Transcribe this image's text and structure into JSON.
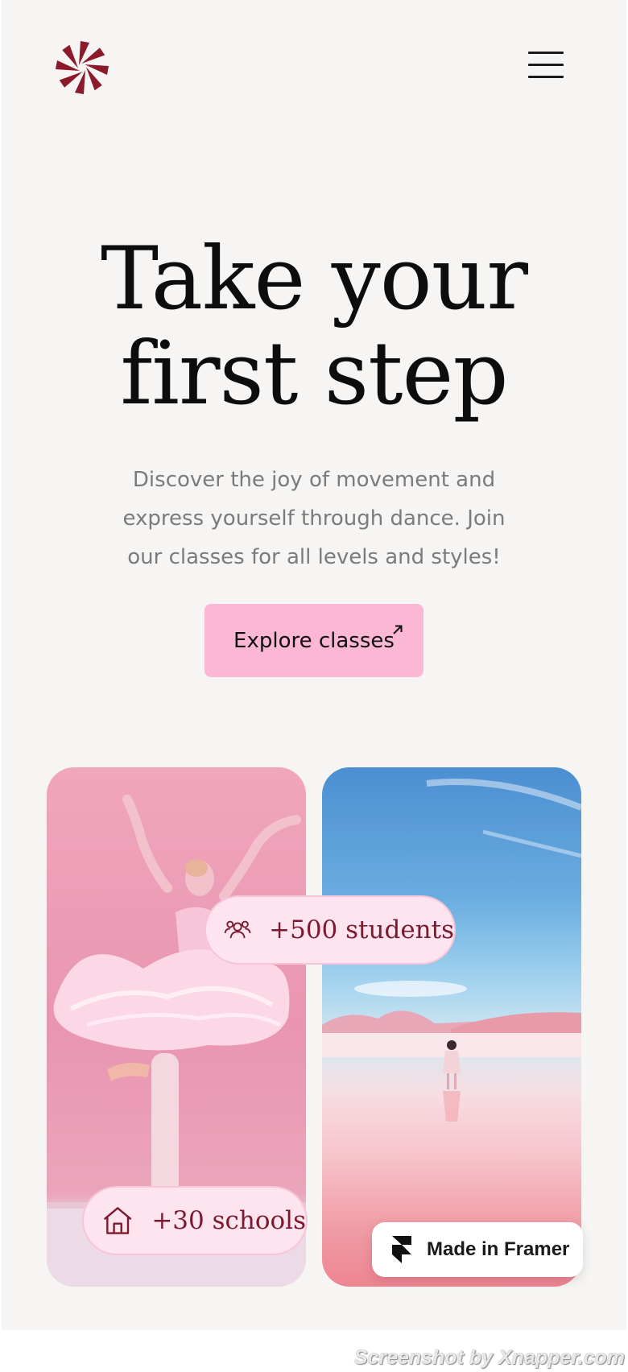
{
  "header": {
    "logo_icon": "pinwheel-logo-icon",
    "menu_icon": "hamburger-menu-icon",
    "brand_color": "#8b1a2b"
  },
  "hero": {
    "title_line1": "Take your",
    "title_line2": "first step",
    "subtitle_line1": "Discover the joy of movement and",
    "subtitle_line2": "express yourself through dance. Join",
    "subtitle_line3": "our classes for all levels and styles!",
    "cta_label": "Explore classes",
    "cta_icon": "arrow-up-right-icon",
    "cta_color": "#fbb7d3"
  },
  "gallery": {
    "left_image": "ballerina-on-pink-background",
    "right_image": "woman-walking-on-pink-salt-flat",
    "students_badge": {
      "icon": "people-group-icon",
      "text": "+500 students"
    },
    "schools_badge": {
      "icon": "house-icon",
      "text": "+30 schools"
    }
  },
  "framer_badge": {
    "icon": "framer-logo-icon",
    "label": "Made in Framer"
  },
  "watermark": "Screenshot by Xnapper.com"
}
